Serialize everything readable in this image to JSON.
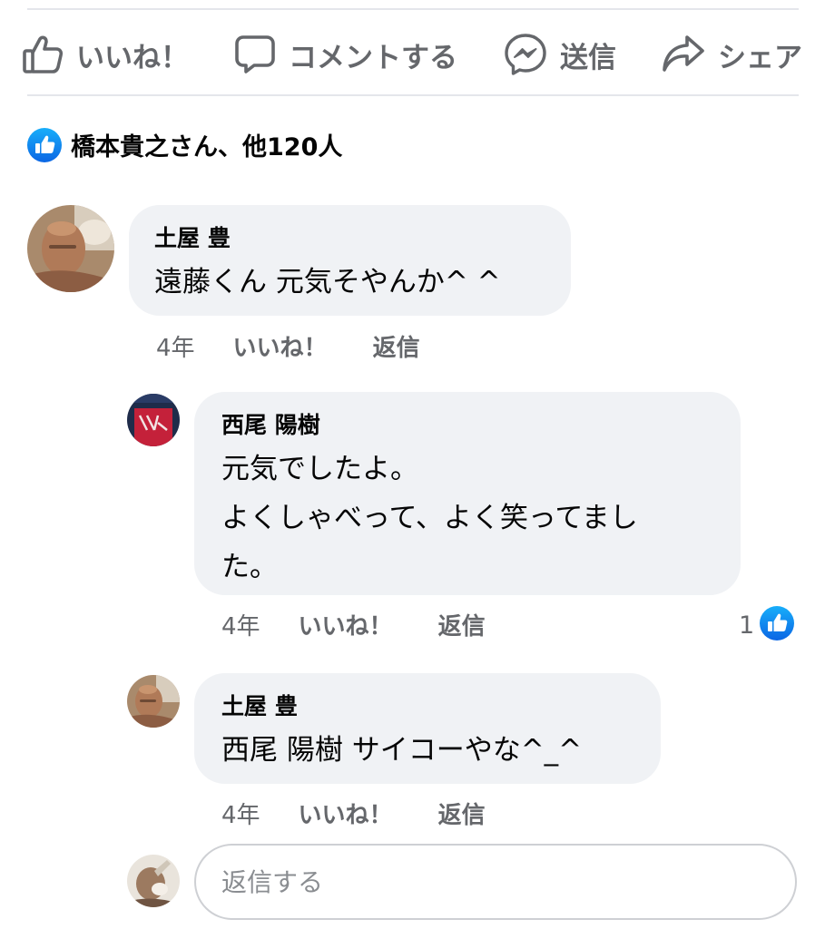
{
  "actions": {
    "like": "いいね！",
    "comment": "コメントする",
    "send": "送信",
    "share": "シェア"
  },
  "reactions": {
    "summary": "橋本貴之さん、他120人"
  },
  "comments": [
    {
      "author": "土屋 豊",
      "lines": [
        "遠藤くん 元気そやんか^ ^"
      ],
      "time": "4年",
      "like_label": "いいね！",
      "reply_label": "返信"
    },
    {
      "author": "西尾 陽樹",
      "lines": [
        "元気でしたよ。",
        "よくしゃべって、よく笑ってまし",
        "た。"
      ],
      "time": "4年",
      "like_label": "いいね！",
      "reply_label": "返信",
      "like_count": "1"
    },
    {
      "author": "土屋 豊",
      "lines": [
        "西尾 陽樹  サイコーやな^_^"
      ],
      "time": "4年",
      "like_label": "いいね！",
      "reply_label": "返信"
    }
  ],
  "reply_box": {
    "placeholder": "返信する"
  },
  "colors": {
    "accent": "#1877f2",
    "secondary_text": "#65676b",
    "bubble": "#f0f2f5"
  }
}
